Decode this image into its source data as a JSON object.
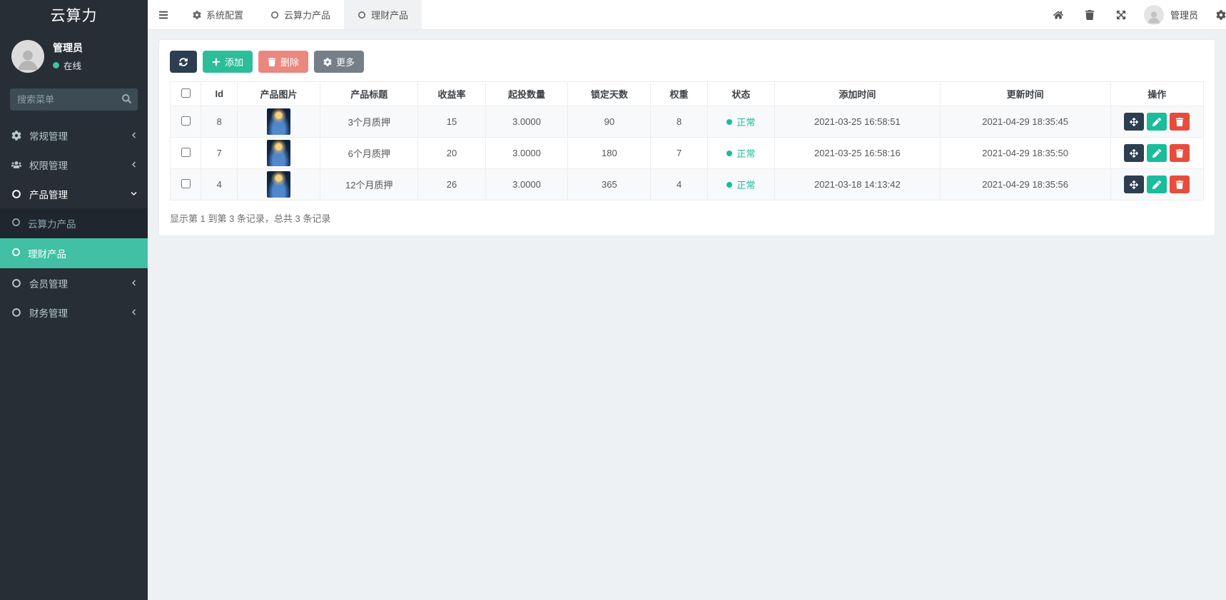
{
  "sidebar": {
    "logo": "云算力",
    "user": {
      "name": "管理员",
      "status": "在线"
    },
    "search_placeholder": "搜索菜单",
    "menu": [
      {
        "label": "常规管理",
        "icon": "cogs-icon",
        "state": "collapsed"
      },
      {
        "label": "权限管理",
        "icon": "users-icon",
        "state": "collapsed"
      },
      {
        "label": "产品管理",
        "icon": "circle-icon",
        "state": "expanded",
        "children": [
          {
            "label": "云算力产品",
            "active": false
          },
          {
            "label": "理财产品",
            "active": true
          }
        ]
      },
      {
        "label": "会员管理",
        "icon": "circle-icon",
        "state": "collapsed"
      },
      {
        "label": "财务管理",
        "icon": "circle-icon",
        "state": "collapsed"
      }
    ]
  },
  "topbar": {
    "tabs": [
      {
        "label": "系统配置",
        "icon": "gear-icon",
        "active": false
      },
      {
        "label": "云算力产品",
        "icon": "circle-icon",
        "active": false
      },
      {
        "label": "理财产品",
        "icon": "circle-icon",
        "active": true
      }
    ],
    "user_name": "管理员"
  },
  "toolbar": {
    "add_label": "添加",
    "delete_label": "删除",
    "more_label": "更多"
  },
  "table": {
    "columns": [
      "Id",
      "产品图片",
      "产品标题",
      "收益率",
      "起投数量",
      "锁定天数",
      "权重",
      "状态",
      "添加时间",
      "更新时间",
      "操作"
    ],
    "rows": [
      {
        "id": "8",
        "title": "3个月质押",
        "rate": "15",
        "min_invest": "3.0000",
        "lock_days": "90",
        "weight": "8",
        "status": "正常",
        "added": "2021-03-25 16:58:51",
        "updated": "2021-04-29 18:35:45"
      },
      {
        "id": "7",
        "title": "6个月质押",
        "rate": "20",
        "min_invest": "3.0000",
        "lock_days": "180",
        "weight": "7",
        "status": "正常",
        "added": "2021-03-25 16:58:16",
        "updated": "2021-04-29 18:35:50"
      },
      {
        "id": "4",
        "title": "12个月质押",
        "rate": "26",
        "min_invest": "3.0000",
        "lock_days": "365",
        "weight": "4",
        "status": "正常",
        "added": "2021-03-18 14:13:42",
        "updated": "2021-04-29 18:35:56"
      }
    ],
    "summary": "显示第 1 到第 3 条记录，总共 3 条记录"
  },
  "colors": {
    "sidebar_bg": "#272e36",
    "submenu_bg": "#20262d",
    "sidebar_active": "#41c0a5",
    "success": "#1abc9c",
    "primary_dark": "#2c3e50",
    "danger": "#e74c3c",
    "danger_muted": "#e8887e",
    "secondary_gray": "#767f88",
    "content_bg": "#eef1f4"
  }
}
